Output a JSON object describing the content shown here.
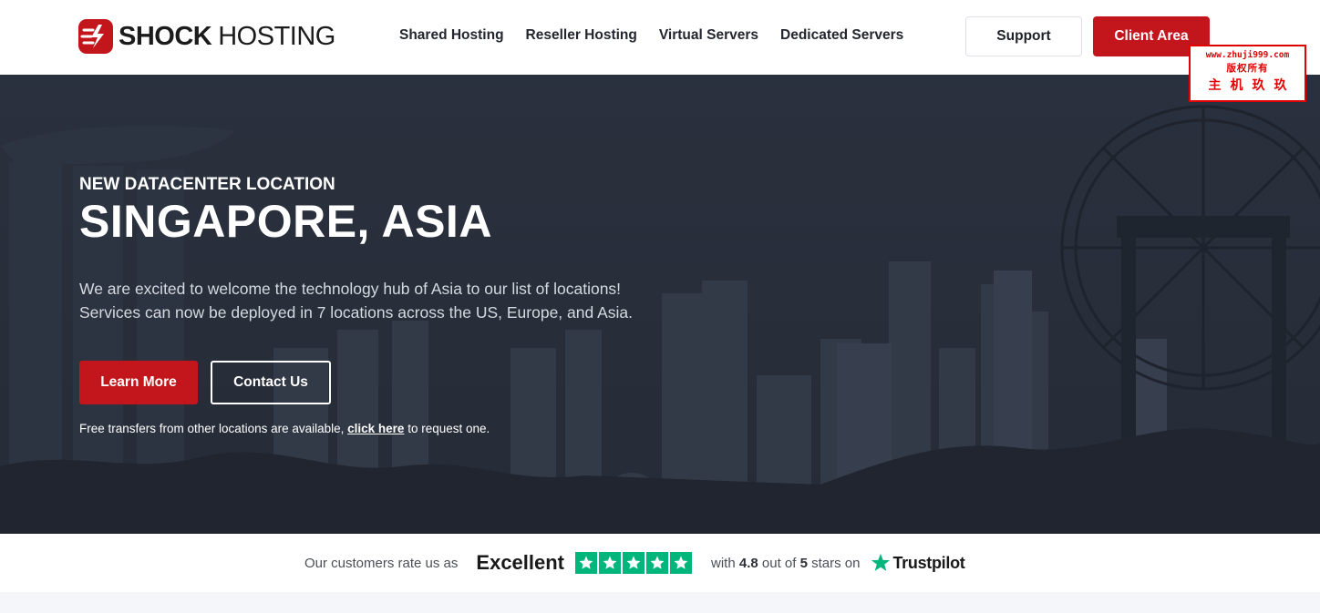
{
  "brand": {
    "name_bold": "SHOCK",
    "name_light": "HOSTING",
    "accent_color": "#c3151c"
  },
  "nav": {
    "items": [
      {
        "label": "Shared Hosting"
      },
      {
        "label": "Reseller Hosting"
      },
      {
        "label": "Virtual Servers"
      },
      {
        "label": "Dedicated Servers"
      }
    ]
  },
  "header_buttons": {
    "support": "Support",
    "client_area": "Client Area"
  },
  "watermark": {
    "url": "www.zhuji999.com",
    "line2": "版权所有",
    "line3": "主机玖玖"
  },
  "hero": {
    "eyebrow": "NEW DATACENTER LOCATION",
    "title": "SINGAPORE, ASIA",
    "description_line1": "We are excited to welcome the technology hub of Asia to our list of locations!",
    "description_line2": "Services can now be deployed in 7 locations across the US, Europe, and Asia.",
    "learn_more": "Learn More",
    "contact_us": "Contact Us",
    "transfer_prefix": "Free transfers from other locations are available, ",
    "transfer_link": "click here",
    "transfer_suffix": " to request one."
  },
  "trust": {
    "prefix": "Our customers rate us as",
    "rating_word": "Excellent",
    "stars": 5,
    "with_text": "with",
    "score": "4.8",
    "out_of_text": "out of",
    "max": "5",
    "stars_on_text": "stars on",
    "provider": "Trustpilot",
    "star_color": "#00b67a"
  }
}
